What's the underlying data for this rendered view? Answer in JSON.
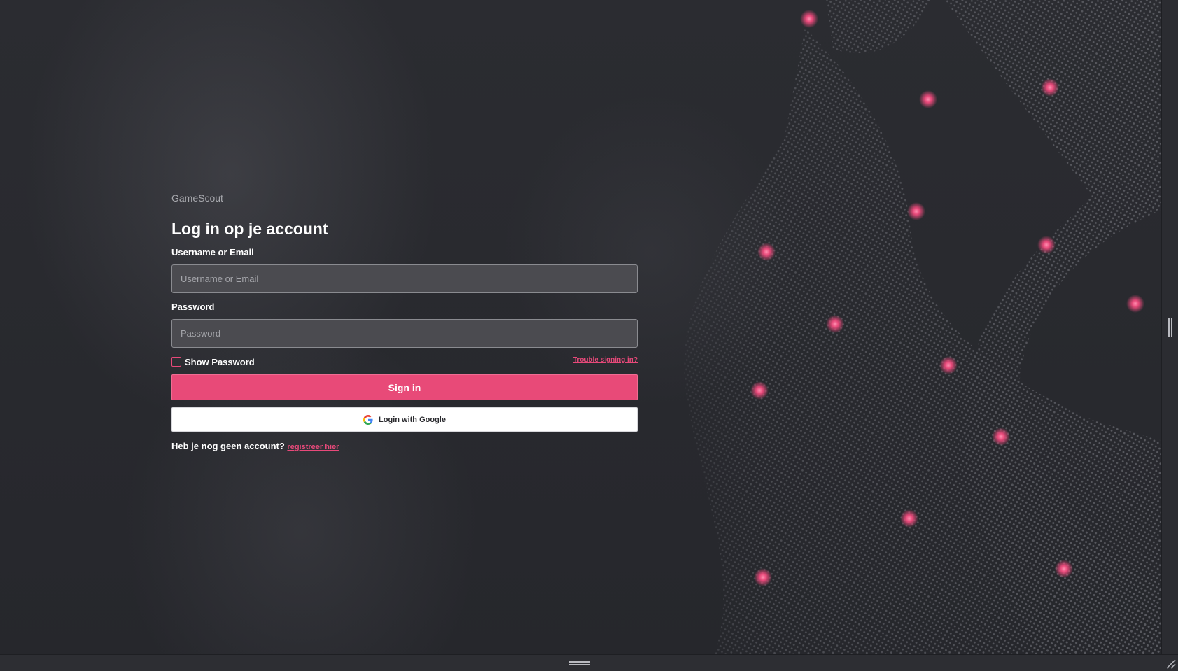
{
  "brand": "GameScout",
  "title": "Log in op je account",
  "username": {
    "label": "Username or Email",
    "placeholder": "Username or Email",
    "value": ""
  },
  "password": {
    "label": "Password",
    "placeholder": "Password",
    "value": ""
  },
  "show_password": {
    "label": "Show Password",
    "checked": false
  },
  "trouble_link": "Trouble signing in?",
  "sign_in_button": "Sign in",
  "google_button": "Login with Google",
  "register": {
    "prompt": "Heb je nog geen account?",
    "link": "registreer hier"
  },
  "colors": {
    "accent": "#e84a78",
    "background": "#2a2b30",
    "input_bg": "#4b4b50",
    "dot": "#e8497a"
  },
  "icons": {
    "google": "google-g-icon",
    "scroll_grip": "vertical-grip-icon",
    "bottom_grip": "horizontal-grip-icon",
    "resize": "resize-corner-icon"
  }
}
